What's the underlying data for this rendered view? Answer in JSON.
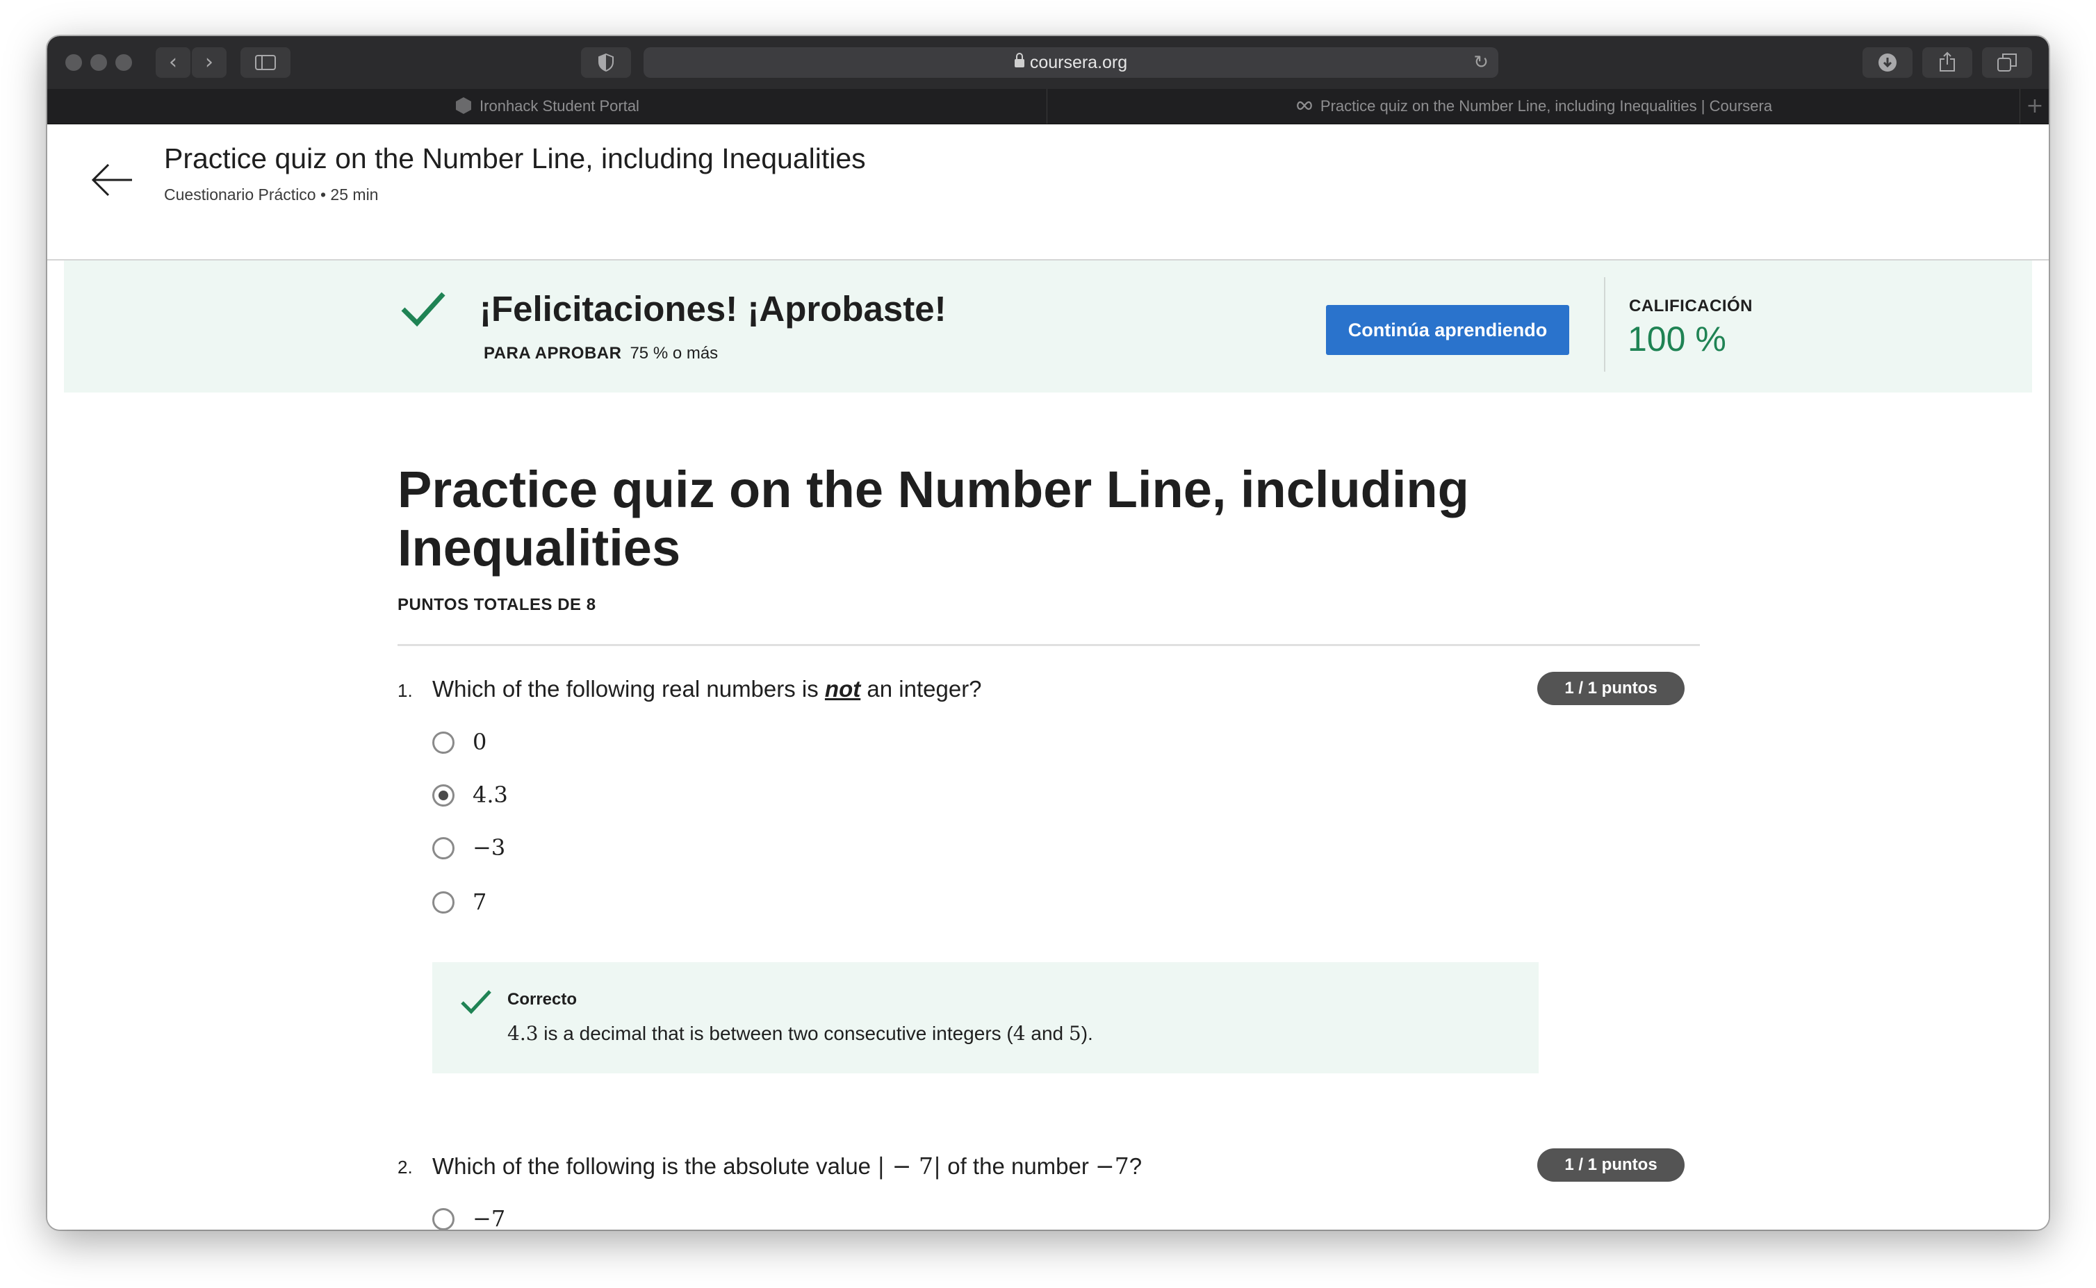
{
  "browser": {
    "url": "coursera.org",
    "tabs": [
      {
        "label": "Ironhack Student Portal",
        "active": false
      },
      {
        "label": "Practice quiz on the Number Line, including Inequalities | Coursera",
        "active": true
      }
    ]
  },
  "header": {
    "title": "Practice quiz on the Number Line, including Inequalities",
    "subtitle": "Cuestionario Práctico • 25 min"
  },
  "result": {
    "message": "¡Felicitaciones! ¡Aprobaste!",
    "pass_label": "PARA APROBAR",
    "pass_threshold": "75 % o más",
    "continue_label": "Continúa aprendiendo",
    "grade_label": "CALIFICACIÓN",
    "grade_value": "100 %"
  },
  "quiz": {
    "title": "Practice quiz on the Number Line, including Inequalities",
    "total_points": "PUNTOS TOTALES DE 8",
    "questions": [
      {
        "number": "1.",
        "text_before": "Which of the following real numbers is ",
        "text_emphasis": "not",
        "text_after": " an integer?",
        "points": "1 / 1 puntos",
        "options": [
          "0",
          "4.3",
          "−3",
          "7"
        ],
        "selected_index": 1,
        "feedback": {
          "title": "Correcto",
          "value": "4.3",
          "text_mid": " is a decimal that is between two consecutive integers (",
          "int_a": "4",
          "and_word": " and ",
          "int_b": "5",
          "close": ")."
        }
      },
      {
        "number": "2.",
        "text_before": "Which of the following is the absolute value ",
        "math_a": "| − 7|",
        "text_mid": " of the number ",
        "math_b": "−7",
        "text_after": "?",
        "points": "1 / 1 puntos",
        "options": [
          "−7"
        ]
      }
    ]
  },
  "colors": {
    "accent": "#2a73cc",
    "success": "#1f8354",
    "banner_bg": "#eef7f3"
  }
}
